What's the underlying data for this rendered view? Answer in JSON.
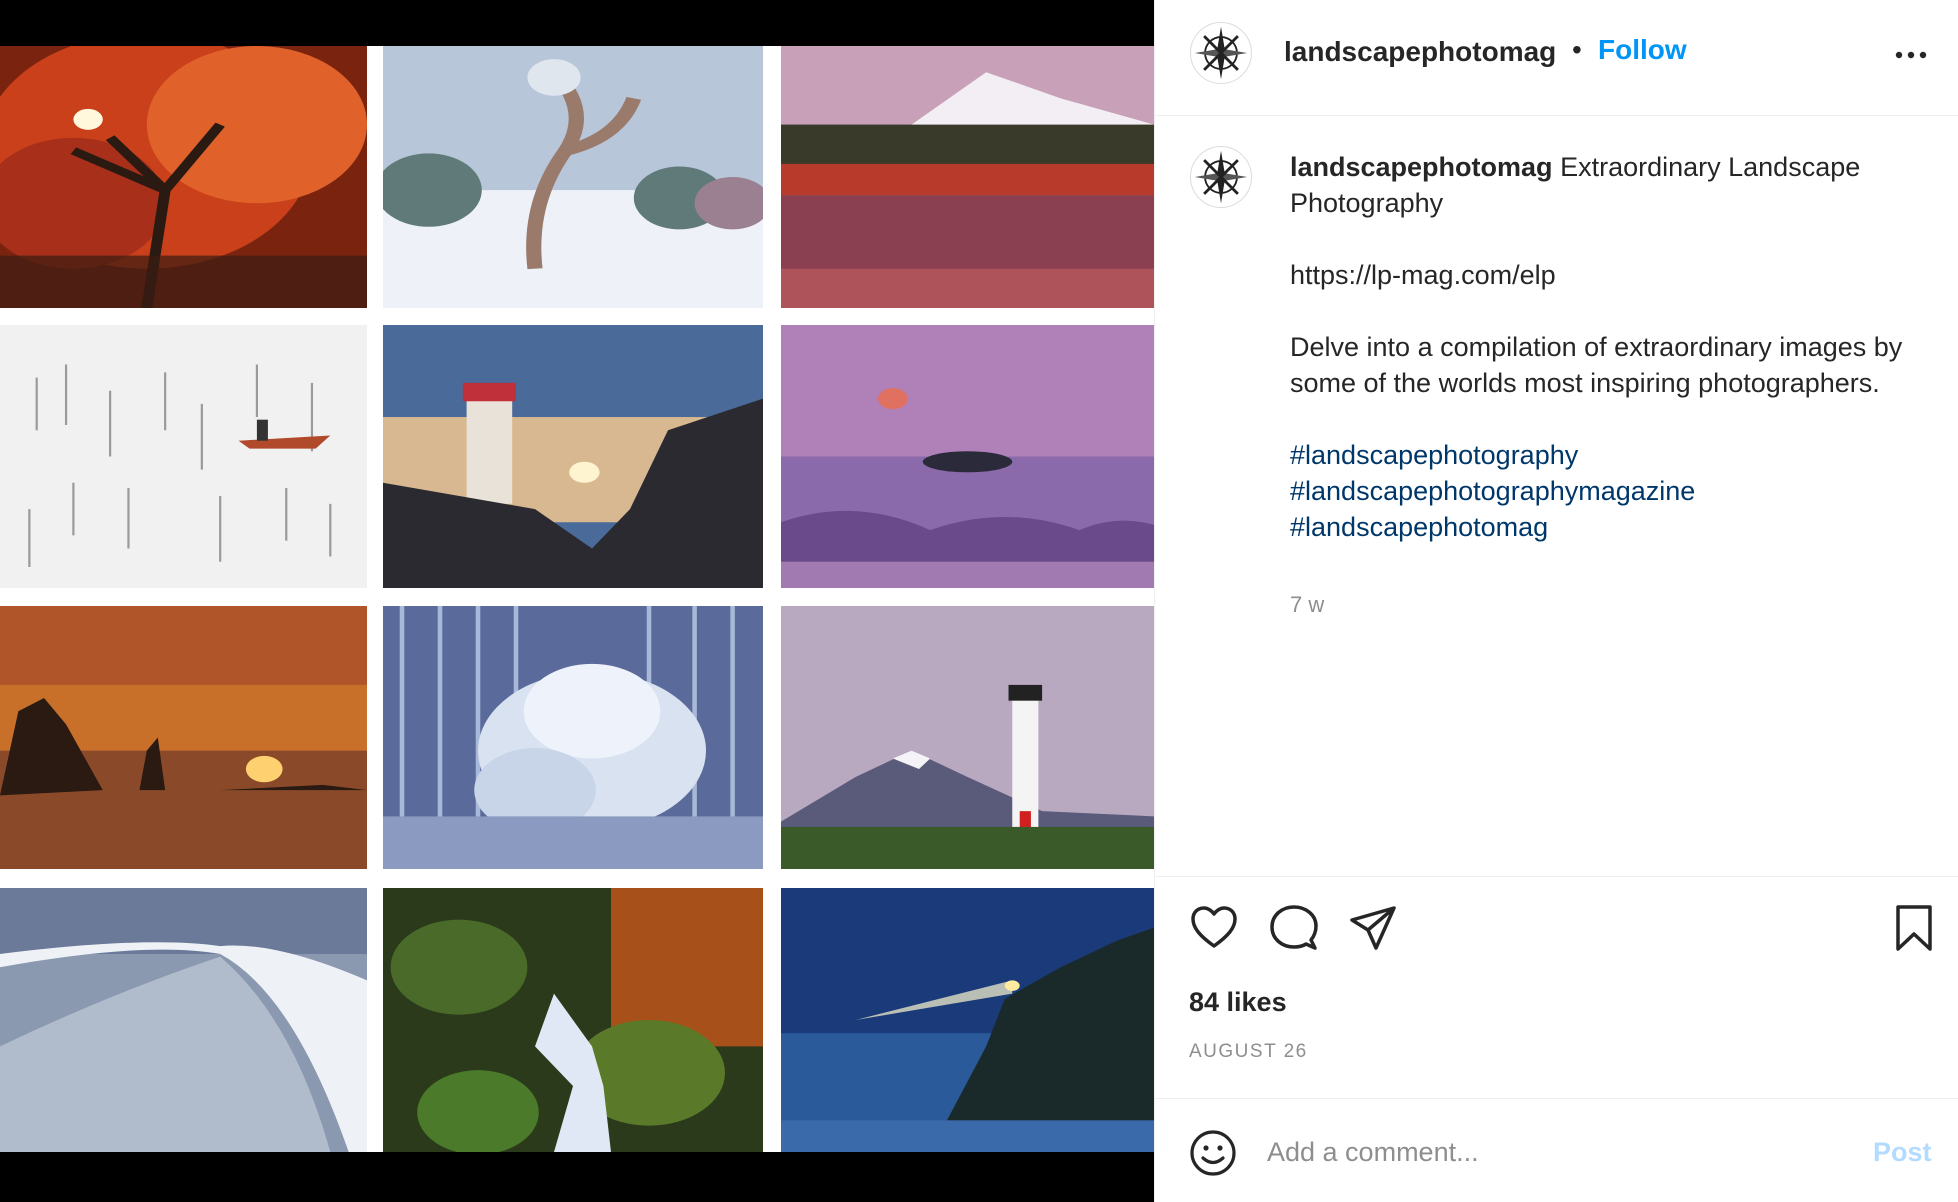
{
  "header": {
    "username": "landscapephotomag",
    "separator": "•",
    "follow_label": "Follow",
    "more_icon": "more-horizontal-icon"
  },
  "caption": {
    "username": "landscapephotomag",
    "title": "Extraordinary Landscape Photography",
    "link": "https://lp-mag.com/elp",
    "description": "Delve into a compilation of extraordinary images by some of the worlds most inspiring photographers.",
    "hashtags": [
      "#landscapephotography",
      "#landscapephotographymagazine",
      "#landscapephotomag"
    ],
    "age": "7 w"
  },
  "actions": {
    "icons": [
      "heart-icon",
      "comment-icon",
      "share-icon",
      "bookmark-icon"
    ],
    "likes": "84 likes",
    "date": "AUGUST 26"
  },
  "comment": {
    "placeholder": "Add a comment...",
    "post_label": "Post",
    "emoji_icon": "emoji-icon"
  },
  "colors": {
    "follow": "#0095f6",
    "hashtag": "#00376b",
    "post_disabled": "#b3dbff",
    "muted": "#8e8e8e"
  }
}
